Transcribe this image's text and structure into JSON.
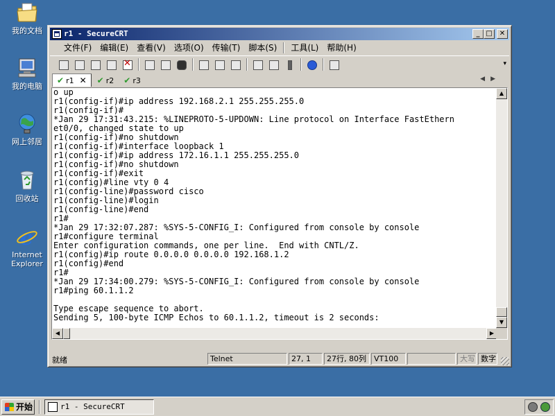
{
  "desktop": {
    "icons": [
      {
        "label": "我的文档",
        "icon": "my-documents-icon"
      },
      {
        "label": "我的电脑",
        "icon": "my-computer-icon"
      },
      {
        "label": "网上邻居",
        "icon": "network-icon"
      },
      {
        "label": "回收站",
        "icon": "recycle-bin-icon"
      },
      {
        "label_line1": "Internet",
        "label_line2": "Explorer",
        "icon": "internet-explorer-icon"
      }
    ]
  },
  "window": {
    "title": "r1 - SecureCRT",
    "buttons": {
      "minimize": "_",
      "maximize": "□",
      "close": "✕"
    }
  },
  "menu": {
    "items": [
      "文件(F)",
      "编辑(E)",
      "查看(V)",
      "选项(O)",
      "传输(T)",
      "脚本(S)",
      "工具(L)",
      "帮助(H)"
    ]
  },
  "tabs": [
    {
      "label": "r1",
      "active": true,
      "close": "✕",
      "check": "✔"
    },
    {
      "label": "r2",
      "active": false,
      "check": "✔"
    },
    {
      "label": "r3",
      "active": false,
      "check": "✔"
    }
  ],
  "terminal": {
    "lines": [
      "o up",
      "r1(config-if)#ip address 192.168.2.1 255.255.255.0",
      "r1(config-if)#",
      "*Jan 29 17:31:43.215: %LINEPROTO-5-UPDOWN: Line protocol on Interface FastEthern",
      "et0/0, changed state to up",
      "r1(config-if)#no shutdown",
      "r1(config-if)#interface loopback 1",
      "r1(config-if)#ip address 172.16.1.1 255.255.255.0",
      "r1(config-if)#no shutdown",
      "r1(config-if)#exit",
      "r1(config)#line vty 0 4",
      "r1(config-line)#password cisco",
      "r1(config-line)#login",
      "r1(config-line)#end",
      "r1#",
      "*Jan 29 17:32:07.287: %SYS-5-CONFIG_I: Configured from console by console",
      "r1#configure terminal",
      "Enter configuration commands, one per line.  End with CNTL/Z.",
      "r1(config)#ip route 0.0.0.0 0.0.0.0 192.168.1.2",
      "r1(config)#end",
      "r1#",
      "*Jan 29 17:34:00.279: %SYS-5-CONFIG_I: Configured from console by console",
      "r1#ping 60.1.1.2",
      "",
      "Type escape sequence to abort.",
      "Sending 5, 100-byte ICMP Echos to 60.1.1.2, timeout is 2 seconds:"
    ]
  },
  "status": {
    "ready": "就绪",
    "protocol": "Telnet",
    "cursor": "27,  1",
    "size": "27行, 80列",
    "emulation": "VT100",
    "caps": "大写",
    "num": "数字"
  },
  "taskbar": {
    "start": "开始",
    "task": "r1 - SecureCRT"
  }
}
